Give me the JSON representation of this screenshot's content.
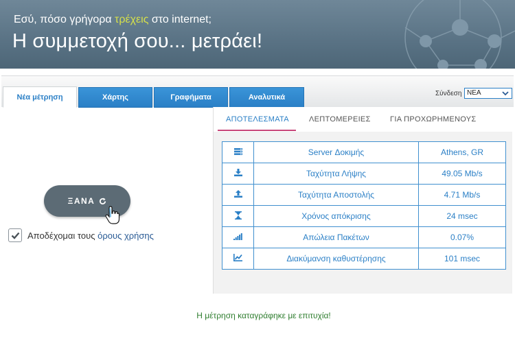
{
  "banner": {
    "line1_before": "Εσύ, πόσο γρήγορα ",
    "line1_highlight": "τρέχεις",
    "line1_after": " στο internet;",
    "line2": "Η συμμετοχή σου... μετράει!"
  },
  "tabs": [
    {
      "label": "Νέα μέτρηση",
      "active": true
    },
    {
      "label": "Χάρτης",
      "active": false
    },
    {
      "label": "Γραφήματα",
      "active": false
    },
    {
      "label": "Αναλυτικά",
      "active": false
    }
  ],
  "connection": {
    "label": "Σύνδεση",
    "selected": "ΝΕΑ"
  },
  "again_button": {
    "label": "ΞΑΝΑ"
  },
  "terms": {
    "prefix": "Αποδέχομαι τους ",
    "link": "όρους χρήσης",
    "checked": true
  },
  "subtabs": [
    {
      "label": "ΑΠΟΤΕΛΕΣΜΑΤΑ",
      "active": true
    },
    {
      "label": "ΛΕΠΤΟΜΕΡΕΙΕΣ",
      "active": false
    },
    {
      "label": "ΓΙΑ ΠΡΟΧΩΡΗΜΕΝΟΥΣ",
      "active": false
    }
  ],
  "results": [
    {
      "icon": "server-icon",
      "label": "Server Δοκιμής",
      "value": "Athens, GR"
    },
    {
      "icon": "download-icon",
      "label": "Ταχύτητα Λήψης",
      "value": "49.05 Mb/s"
    },
    {
      "icon": "upload-icon",
      "label": "Ταχύτητα Αποστολής",
      "value": "4.71 Mb/s"
    },
    {
      "icon": "hourglass-icon",
      "label": "Χρόνος απόκρισης",
      "value": "24 msec"
    },
    {
      "icon": "signal-bars-icon",
      "label": "Απώλεια Πακέτων",
      "value": "0.07%"
    },
    {
      "icon": "line-chart-icon",
      "label": "Διακύμανση καθυστέρησης",
      "value": "101 msec"
    }
  ],
  "status_message": "Η μέτρηση καταγράφηκε με επιτυχία!",
  "colors": {
    "accent": "#2a7fc6",
    "banner": "#5b7486",
    "underline": "#c8467a",
    "success": "#2e7d2e"
  }
}
